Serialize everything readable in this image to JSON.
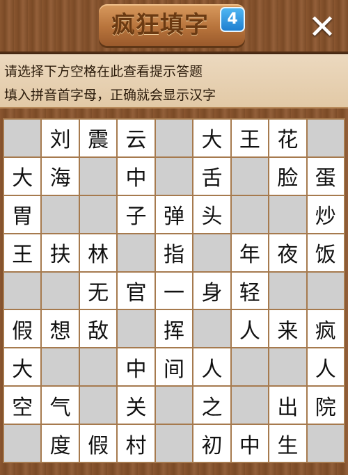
{
  "header": {
    "title": "疯狂填字",
    "level": "4",
    "close_glyph": "✕"
  },
  "hint": {
    "line1": "请选择下方空格在此查看提示答题",
    "line2": "填入拼音首字母，正确就会显示汉字"
  },
  "colors": {
    "wood": "#7a4a24",
    "cell_filled": "#ffffff",
    "cell_blank": "#cfcfcf",
    "badge_blue": "#2f8fe0"
  },
  "grid": [
    [
      "",
      "刘",
      "震",
      "云",
      "",
      "大",
      "王",
      "花",
      ""
    ],
    [
      "大",
      "海",
      "",
      "中",
      "",
      "舌",
      "",
      "脸",
      "蛋"
    ],
    [
      "胃",
      "",
      "",
      "子",
      "弹",
      "头",
      "",
      "",
      "炒"
    ],
    [
      "王",
      "扶",
      "林",
      "",
      "指",
      "",
      "年",
      "夜",
      "饭"
    ],
    [
      "",
      "",
      "无",
      "官",
      "一",
      "身",
      "轻",
      "",
      ""
    ],
    [
      "假",
      "想",
      "敌",
      "",
      "挥",
      "",
      "人",
      "来",
      "疯"
    ],
    [
      "大",
      "",
      "",
      "中",
      "间",
      "人",
      "",
      "",
      "人"
    ],
    [
      "空",
      "气",
      "",
      "关",
      "",
      "之",
      "",
      "出",
      "院"
    ],
    [
      "",
      "度",
      "假",
      "村",
      "",
      "初",
      "中",
      "生",
      ""
    ]
  ]
}
